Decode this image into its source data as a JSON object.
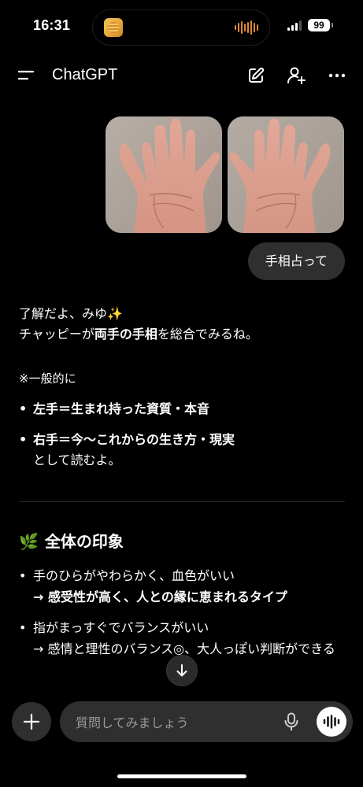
{
  "status_bar": {
    "time": "16:31",
    "battery": "99"
  },
  "header": {
    "title": "ChatGPT"
  },
  "icons": {
    "menu": "menu-icon",
    "edit": "edit-icon",
    "add_person": "add-person-icon",
    "more": "more-icon",
    "leaf": "leaf-emoji",
    "sparkle": "sparkles-emoji",
    "scroll_down": "arrow-down-icon",
    "plus": "plus-icon",
    "mic": "mic-icon",
    "voice": "voice-waveform-icon"
  },
  "chat": {
    "user_message": "手相占って",
    "reply": {
      "greeting": "了解だよ、みゆ",
      "sparkle": "✨",
      "intro_before": "チャッピーが",
      "intro_bold": "両手の手相",
      "intro_after": "を総合でみるね。",
      "note": "※一般的に",
      "hands": [
        {
          "text": "左手＝生まれ持った資質・本音",
          "extra": ""
        },
        {
          "text": "右手＝今〜これからの生き方・現実",
          "extra": "として読むよ。"
        }
      ],
      "section": {
        "emoji": "🌿",
        "title": "全体の印象",
        "items": [
          {
            "line1": "手のひらがやわらかく、血色がいい",
            "line2": "→ 感受性が高く、人との縁に恵まれるタイプ",
            "line2_bold": true
          },
          {
            "line1": "指がまっすぐでバランスがいい",
            "line2": "→ 感情と理性のバランス◎、大人っぽい判断ができる",
            "line2_bold": false
          }
        ]
      }
    }
  },
  "composer": {
    "placeholder": "質問してみましょう"
  },
  "colors": {
    "background": "#000000",
    "bubble": "#2f2f2f",
    "text": "#ffffff",
    "placeholder": "#9a9a9a",
    "island_wave": "#e08a3a"
  }
}
